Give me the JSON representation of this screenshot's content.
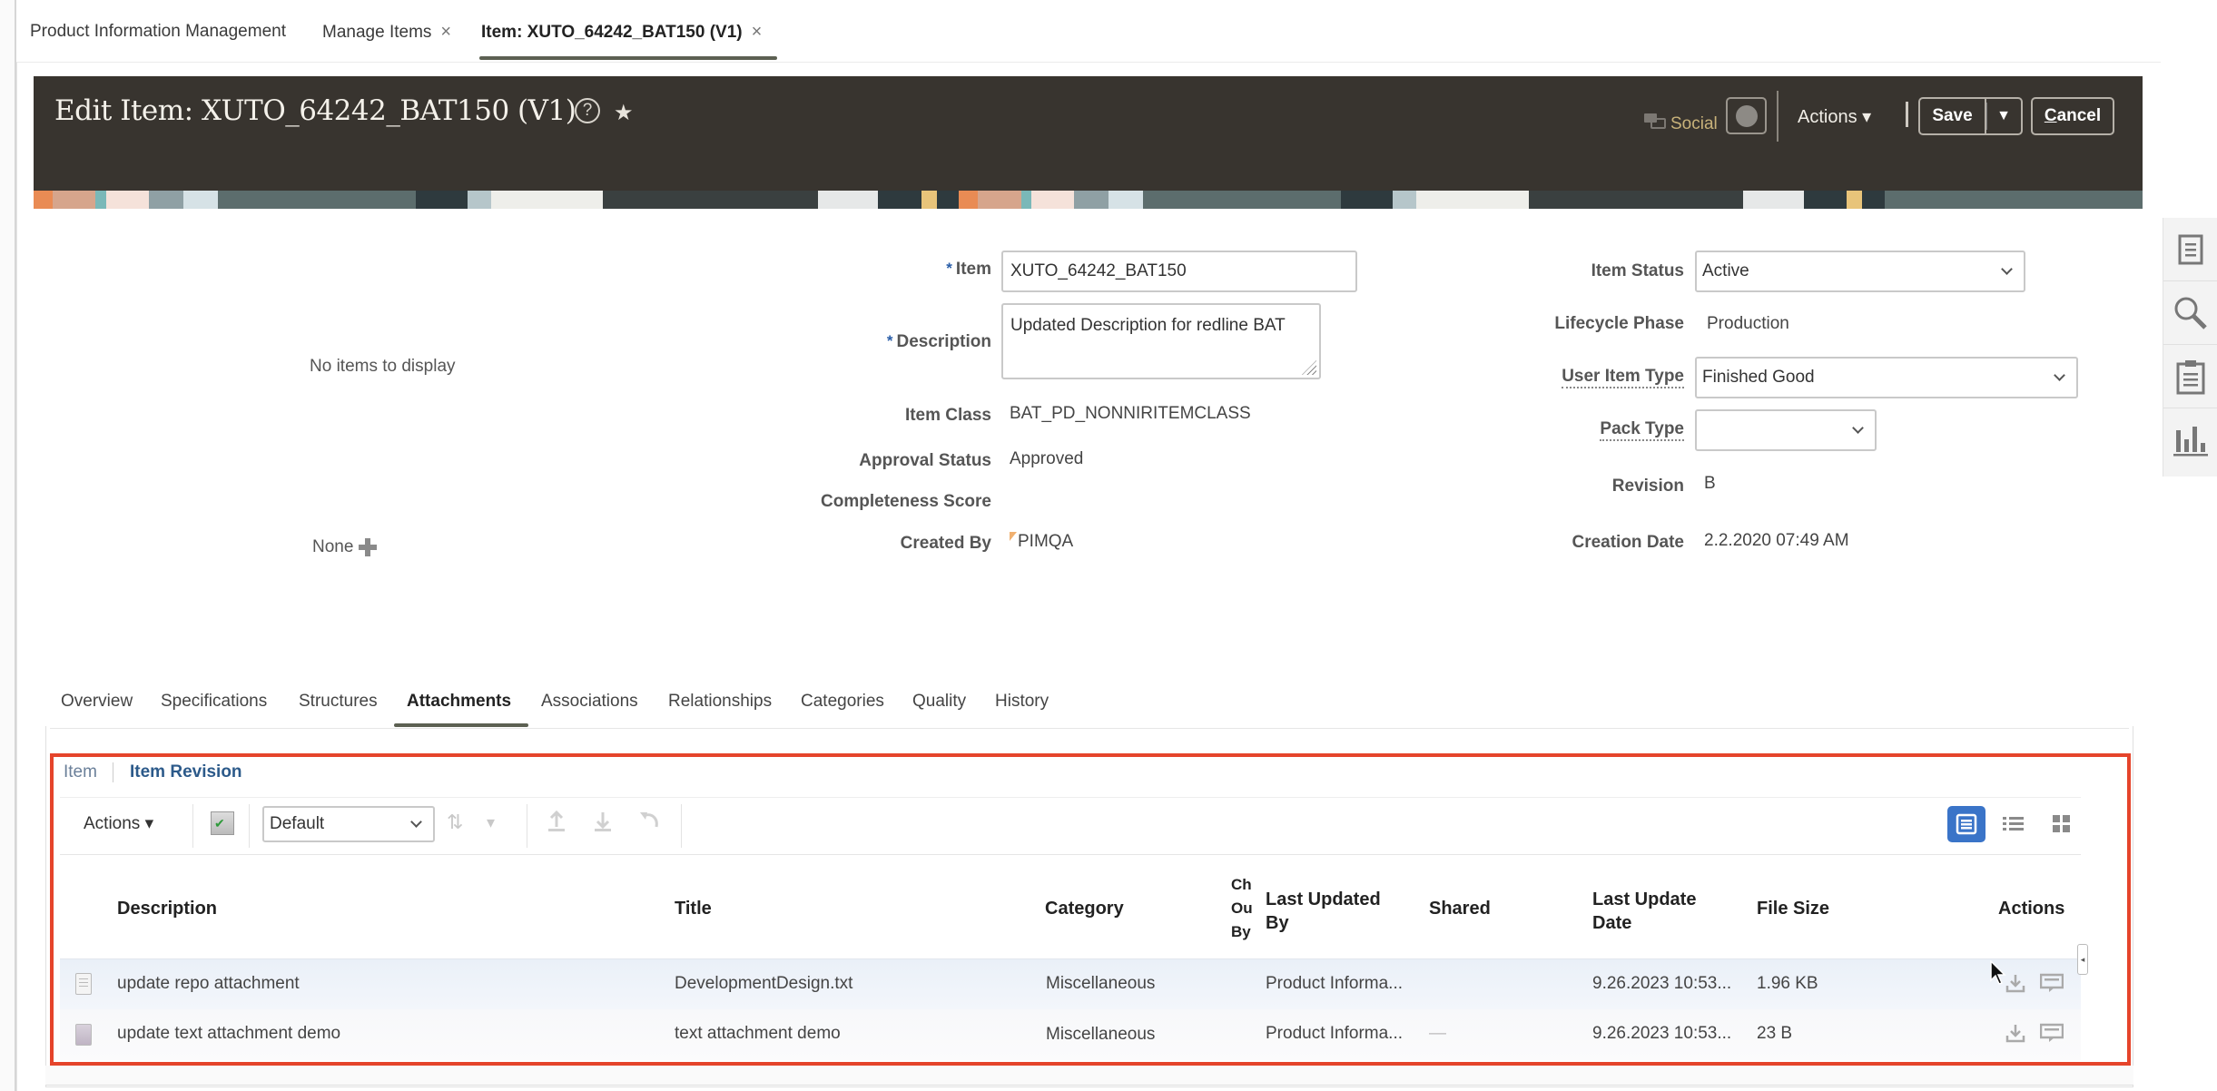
{
  "top_tabs": [
    {
      "label": "Product Information Management",
      "closable": false,
      "active": false
    },
    {
      "label": "Manage Items",
      "closable": true,
      "active": false
    },
    {
      "label": "Item: XUTO_64242_BAT150 (V1)",
      "closable": true,
      "active": true
    }
  ],
  "close_glyph": "×",
  "header": {
    "title": "Edit Item: XUTO_64242_BAT150 (V1)",
    "help_glyph": "?",
    "favorite_glyph": "★",
    "social_label": "Social",
    "actions_label": "Actions ▾",
    "save_label": "Save",
    "save_menu_glyph": "▼",
    "cancel_label_prefix": "C",
    "cancel_label_rest": "ancel"
  },
  "left_panel": {
    "empty_text": "No items to display",
    "none_label": "None"
  },
  "form_left": {
    "item": {
      "label": "Item",
      "required": true,
      "value": "XUTO_64242_BAT150"
    },
    "description": {
      "label": "Description",
      "required": true,
      "value": "Updated Description for redline BAT"
    },
    "item_class": {
      "label": "Item Class",
      "value": "BAT_PD_NONNIRITEMCLASS"
    },
    "approval_status": {
      "label": "Approval Status",
      "value": "Approved"
    },
    "completeness_score": {
      "label": "Completeness Score",
      "value": ""
    },
    "created_by": {
      "label": "Created By",
      "value": "PIMQA"
    }
  },
  "required_glyph": "*",
  "form_right": {
    "item_status": {
      "label": "Item Status",
      "value": "Active"
    },
    "lifecycle_phase": {
      "label": "Lifecycle Phase",
      "value": "Production"
    },
    "user_item_type": {
      "label": "User Item Type",
      "value": "Finished Good"
    },
    "pack_type": {
      "label": "Pack Type",
      "value": ""
    },
    "revision": {
      "label": "Revision",
      "value": "B"
    },
    "creation_date": {
      "label": "Creation Date",
      "value": "2.2.2020 07:49 AM"
    }
  },
  "right_rail": [
    "document-icon",
    "search-icon",
    "clipboard-icon",
    "bar-chart-icon"
  ],
  "sub_tabs": [
    {
      "label": "Overview",
      "active": false
    },
    {
      "label": "Specifications",
      "active": false
    },
    {
      "label": "Structures",
      "active": false
    },
    {
      "label": "Attachments",
      "active": true
    },
    {
      "label": "Associations",
      "active": false
    },
    {
      "label": "Relationships",
      "active": false
    },
    {
      "label": "Categories",
      "active": false
    },
    {
      "label": "Quality",
      "active": false
    },
    {
      "label": "History",
      "active": false
    }
  ],
  "attachments": {
    "level_tabs": [
      {
        "label": "Item",
        "active": false
      },
      {
        "label": "Item Revision",
        "active": true
      }
    ],
    "toolbar": {
      "actions_label": "Actions ▾",
      "view_select_value": "Default",
      "sort_glyph": "⇅",
      "sort_menu_glyph": "▾"
    },
    "columns": {
      "description": "Description",
      "title": "Title",
      "category": "Category",
      "checked_out_by": [
        "Ch",
        "Ou",
        "By"
      ],
      "last_updated_by": [
        "Last Updated",
        "By"
      ],
      "shared": "Shared",
      "last_update_date": [
        "Last Update",
        "Date"
      ],
      "file_size": "File Size",
      "actions": "Actions"
    },
    "rows": [
      {
        "type": "file",
        "description": "update repo attachment",
        "title": "DevelopmentDesign.txt",
        "category": "Miscellaneous",
        "checked_out_by": "",
        "last_updated_by": "Product Informa...",
        "shared": "",
        "last_update_date": "9.26.2023 10:53...",
        "file_size": "1.96 KB"
      },
      {
        "type": "text",
        "description": "update text attachment demo",
        "title": "text attachment demo",
        "category": "Miscellaneous",
        "checked_out_by": "",
        "last_updated_by": "Product Informa...",
        "shared": "—",
        "last_update_date": "9.26.2023 10:53...",
        "file_size": "23 B"
      }
    ]
  },
  "colors": {
    "header_bg": "#38342f",
    "highlight_border": "#e5442b",
    "accent_blue": "#3a74c8",
    "social_gold": "#c8b27a"
  }
}
